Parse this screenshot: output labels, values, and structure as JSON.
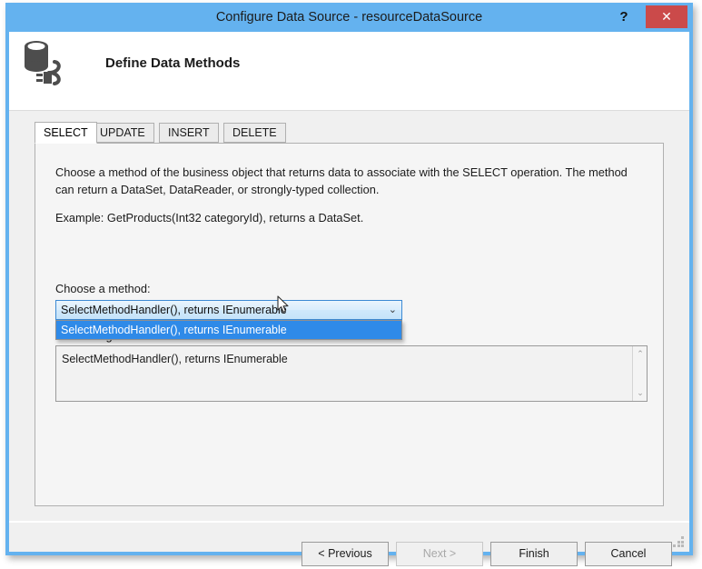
{
  "window": {
    "title": "Configure Data Source - resourceDataSource",
    "help_label": "?",
    "close_label": "✕",
    "titlebar_color": "#64b2ef",
    "close_color": "#cb4a4a"
  },
  "header": {
    "title": "Define Data Methods",
    "icon": "database-plug-icon"
  },
  "tabs": [
    {
      "label": "SELECT",
      "active": true
    },
    {
      "label": "UPDATE",
      "active": false
    },
    {
      "label": "INSERT",
      "active": false
    },
    {
      "label": "DELETE",
      "active": false
    }
  ],
  "panel": {
    "description": "Choose a method of the business object that returns data to associate with the SELECT operation. The method can return a DataSet, DataReader, or strongly-typed collection.",
    "example": "Example: GetProducts(Int32 categoryId), returns a DataSet.",
    "choose_label": "Choose a method:",
    "signature_label": "Method signature:",
    "combo": {
      "value": "SelectMethodHandler(), returns IEnumerable",
      "arrow_glyph": "⌄",
      "open": true,
      "options": [
        "SelectMethodHandler(), returns IEnumerable"
      ],
      "selected_index": 0,
      "highlight_color": "#2f8ae8"
    },
    "signature_value": "SelectMethodHandler(), returns IEnumerable",
    "scroll_up_glyph": "⌃",
    "scroll_down_glyph": "⌄"
  },
  "footer": {
    "previous_label": "< Previous",
    "next_label": "Next >",
    "next_disabled": true,
    "finish_label": "Finish",
    "cancel_label": "Cancel"
  }
}
